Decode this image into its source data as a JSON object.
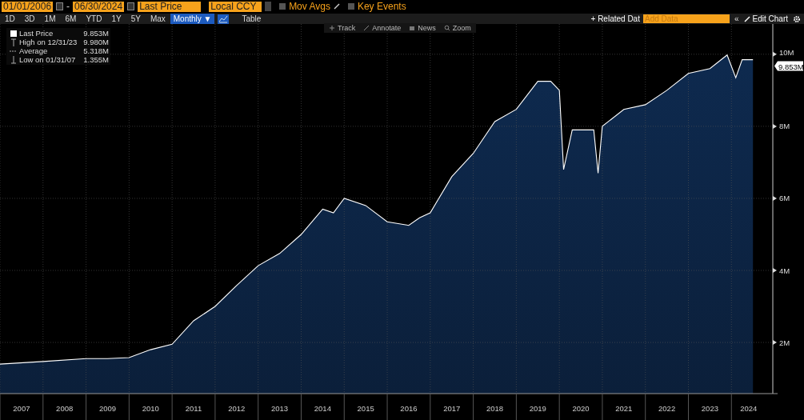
{
  "header": {
    "start_date": "01/01/2006",
    "date_separator": "-",
    "end_date": "06/30/2024",
    "field": "Last Price",
    "currency": "Local CCY",
    "toggles": [
      {
        "label": "Mov Avgs",
        "checked": false,
        "kind": "pencil"
      },
      {
        "label": "Key Events",
        "checked": false,
        "kind": "plain"
      }
    ]
  },
  "periods": [
    {
      "label": "1D",
      "selected": false
    },
    {
      "label": "3D",
      "selected": false
    },
    {
      "label": "1M",
      "selected": false
    },
    {
      "label": "6M",
      "selected": false
    },
    {
      "label": "YTD",
      "selected": false
    },
    {
      "label": "1Y",
      "selected": false
    },
    {
      "label": "5Y",
      "selected": false
    },
    {
      "label": "Max",
      "selected": false
    }
  ],
  "frequency": "Monthly ▼",
  "table_button": "Table",
  "related": "+ Related Dat",
  "add_data": {
    "placeholder": "Add Data"
  },
  "collapse": "«",
  "edit_chart": "Edit Chart",
  "tools": [
    "Track",
    "Annotate",
    "News",
    "Zoom"
  ],
  "legend": [
    {
      "kind": "last",
      "value": "9.853M"
    },
    {
      "kind": "high",
      "label": "High on 12/31/23",
      "value": "9.980M"
    },
    {
      "kind": "average",
      "label": "Average",
      "value": "5.318M"
    },
    {
      "kind": "low",
      "label": "Low on 01/31/07",
      "value": "1.355M"
    }
  ],
  "last_tag": "9.853M",
  "chart_data": {
    "type": "area",
    "x": [
      2007.0,
      2008.0,
      2009.0,
      2009.5,
      2010.0,
      2010.5,
      2011.0,
      2011.5,
      2012.0,
      2012.5,
      2013.0,
      2013.5,
      2014.0,
      2014.5,
      2014.75,
      2015.0,
      2015.5,
      2016.0,
      2016.5,
      2016.75,
      2017.0,
      2017.5,
      2018.0,
      2018.5,
      2019.0,
      2019.5,
      2019.8,
      2020.0,
      2020.1,
      2020.3,
      2020.8,
      2020.9,
      2021.0,
      2021.5,
      2022.0,
      2022.5,
      2023.0,
      2023.5,
      2023.9,
      2024.1,
      2024.25,
      2024.5
    ],
    "series": [
      {
        "name": "Last Price",
        "color": "#ffffff",
        "values": [
          1.4,
          1.47,
          1.55,
          1.55,
          1.58,
          1.8,
          1.95,
          2.6,
          3.0,
          3.58,
          4.13,
          4.47,
          5.0,
          5.7,
          5.6,
          6.0,
          5.8,
          5.35,
          5.25,
          5.46,
          5.6,
          6.6,
          7.25,
          8.13,
          8.47,
          9.25,
          9.25,
          9.0,
          6.8,
          7.9,
          7.9,
          6.7,
          8.0,
          8.47,
          8.6,
          9.0,
          9.47,
          9.6,
          9.98,
          9.35,
          9.85,
          9.85
        ]
      }
    ],
    "grid": true,
    "xlim": [
      2007,
      2024.85
    ],
    "ylim": [
      0.58,
      10.84
    ],
    "xticks": [
      {
        "value": 2007.5,
        "label": "2007"
      },
      {
        "value": 2008.5,
        "label": "2008"
      },
      {
        "value": 2009.5,
        "label": "2009"
      },
      {
        "value": 2010.5,
        "label": "2010"
      },
      {
        "value": 2011.5,
        "label": "2011"
      },
      {
        "value": 2012.5,
        "label": "2012"
      },
      {
        "value": 2013.5,
        "label": "2013"
      },
      {
        "value": 2014.5,
        "label": "2014"
      },
      {
        "value": 2015.5,
        "label": "2015"
      },
      {
        "value": 2016.5,
        "label": "2016"
      },
      {
        "value": 2017.5,
        "label": "2017"
      },
      {
        "value": 2018.5,
        "label": "2018"
      },
      {
        "value": 2019.5,
        "label": "2019"
      },
      {
        "value": 2020.5,
        "label": "2020"
      },
      {
        "value": 2021.5,
        "label": "2021"
      },
      {
        "value": 2022.5,
        "label": "2022"
      },
      {
        "value": 2023.5,
        "label": "2023"
      },
      {
        "value": 2024.4,
        "label": "2024"
      }
    ],
    "yticks": [
      {
        "value": 2,
        "label": "2M"
      },
      {
        "value": 4,
        "label": "4M"
      },
      {
        "value": 6,
        "label": "6M"
      },
      {
        "value": 8,
        "label": "8M"
      },
      {
        "value": 10,
        "label": "10M"
      }
    ]
  }
}
